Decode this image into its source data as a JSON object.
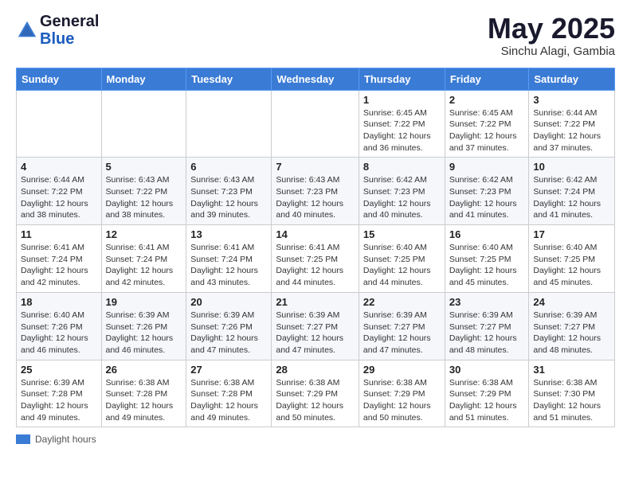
{
  "header": {
    "logo_general": "General",
    "logo_blue": "Blue",
    "title": "May 2025",
    "location": "Sinchu Alagi, Gambia"
  },
  "days_of_week": [
    "Sunday",
    "Monday",
    "Tuesday",
    "Wednesday",
    "Thursday",
    "Friday",
    "Saturday"
  ],
  "weeks": [
    [
      {
        "day": "",
        "sunrise": "",
        "sunset": "",
        "daylight": ""
      },
      {
        "day": "",
        "sunrise": "",
        "sunset": "",
        "daylight": ""
      },
      {
        "day": "",
        "sunrise": "",
        "sunset": "",
        "daylight": ""
      },
      {
        "day": "",
        "sunrise": "",
        "sunset": "",
        "daylight": ""
      },
      {
        "day": "1",
        "sunrise": "Sunrise: 6:45 AM",
        "sunset": "Sunset: 7:22 PM",
        "daylight": "Daylight: 12 hours and 36 minutes."
      },
      {
        "day": "2",
        "sunrise": "Sunrise: 6:45 AM",
        "sunset": "Sunset: 7:22 PM",
        "daylight": "Daylight: 12 hours and 37 minutes."
      },
      {
        "day": "3",
        "sunrise": "Sunrise: 6:44 AM",
        "sunset": "Sunset: 7:22 PM",
        "daylight": "Daylight: 12 hours and 37 minutes."
      }
    ],
    [
      {
        "day": "4",
        "sunrise": "Sunrise: 6:44 AM",
        "sunset": "Sunset: 7:22 PM",
        "daylight": "Daylight: 12 hours and 38 minutes."
      },
      {
        "day": "5",
        "sunrise": "Sunrise: 6:43 AM",
        "sunset": "Sunset: 7:22 PM",
        "daylight": "Daylight: 12 hours and 38 minutes."
      },
      {
        "day": "6",
        "sunrise": "Sunrise: 6:43 AM",
        "sunset": "Sunset: 7:23 PM",
        "daylight": "Daylight: 12 hours and 39 minutes."
      },
      {
        "day": "7",
        "sunrise": "Sunrise: 6:43 AM",
        "sunset": "Sunset: 7:23 PM",
        "daylight": "Daylight: 12 hours and 40 minutes."
      },
      {
        "day": "8",
        "sunrise": "Sunrise: 6:42 AM",
        "sunset": "Sunset: 7:23 PM",
        "daylight": "Daylight: 12 hours and 40 minutes."
      },
      {
        "day": "9",
        "sunrise": "Sunrise: 6:42 AM",
        "sunset": "Sunset: 7:23 PM",
        "daylight": "Daylight: 12 hours and 41 minutes."
      },
      {
        "day": "10",
        "sunrise": "Sunrise: 6:42 AM",
        "sunset": "Sunset: 7:24 PM",
        "daylight": "Daylight: 12 hours and 41 minutes."
      }
    ],
    [
      {
        "day": "11",
        "sunrise": "Sunrise: 6:41 AM",
        "sunset": "Sunset: 7:24 PM",
        "daylight": "Daylight: 12 hours and 42 minutes."
      },
      {
        "day": "12",
        "sunrise": "Sunrise: 6:41 AM",
        "sunset": "Sunset: 7:24 PM",
        "daylight": "Daylight: 12 hours and 42 minutes."
      },
      {
        "day": "13",
        "sunrise": "Sunrise: 6:41 AM",
        "sunset": "Sunset: 7:24 PM",
        "daylight": "Daylight: 12 hours and 43 minutes."
      },
      {
        "day": "14",
        "sunrise": "Sunrise: 6:41 AM",
        "sunset": "Sunset: 7:25 PM",
        "daylight": "Daylight: 12 hours and 44 minutes."
      },
      {
        "day": "15",
        "sunrise": "Sunrise: 6:40 AM",
        "sunset": "Sunset: 7:25 PM",
        "daylight": "Daylight: 12 hours and 44 minutes."
      },
      {
        "day": "16",
        "sunrise": "Sunrise: 6:40 AM",
        "sunset": "Sunset: 7:25 PM",
        "daylight": "Daylight: 12 hours and 45 minutes."
      },
      {
        "day": "17",
        "sunrise": "Sunrise: 6:40 AM",
        "sunset": "Sunset: 7:25 PM",
        "daylight": "Daylight: 12 hours and 45 minutes."
      }
    ],
    [
      {
        "day": "18",
        "sunrise": "Sunrise: 6:40 AM",
        "sunset": "Sunset: 7:26 PM",
        "daylight": "Daylight: 12 hours and 46 minutes."
      },
      {
        "day": "19",
        "sunrise": "Sunrise: 6:39 AM",
        "sunset": "Sunset: 7:26 PM",
        "daylight": "Daylight: 12 hours and 46 minutes."
      },
      {
        "day": "20",
        "sunrise": "Sunrise: 6:39 AM",
        "sunset": "Sunset: 7:26 PM",
        "daylight": "Daylight: 12 hours and 47 minutes."
      },
      {
        "day": "21",
        "sunrise": "Sunrise: 6:39 AM",
        "sunset": "Sunset: 7:27 PM",
        "daylight": "Daylight: 12 hours and 47 minutes."
      },
      {
        "day": "22",
        "sunrise": "Sunrise: 6:39 AM",
        "sunset": "Sunset: 7:27 PM",
        "daylight": "Daylight: 12 hours and 47 minutes."
      },
      {
        "day": "23",
        "sunrise": "Sunrise: 6:39 AM",
        "sunset": "Sunset: 7:27 PM",
        "daylight": "Daylight: 12 hours and 48 minutes."
      },
      {
        "day": "24",
        "sunrise": "Sunrise: 6:39 AM",
        "sunset": "Sunset: 7:27 PM",
        "daylight": "Daylight: 12 hours and 48 minutes."
      }
    ],
    [
      {
        "day": "25",
        "sunrise": "Sunrise: 6:39 AM",
        "sunset": "Sunset: 7:28 PM",
        "daylight": "Daylight: 12 hours and 49 minutes."
      },
      {
        "day": "26",
        "sunrise": "Sunrise: 6:38 AM",
        "sunset": "Sunset: 7:28 PM",
        "daylight": "Daylight: 12 hours and 49 minutes."
      },
      {
        "day": "27",
        "sunrise": "Sunrise: 6:38 AM",
        "sunset": "Sunset: 7:28 PM",
        "daylight": "Daylight: 12 hours and 49 minutes."
      },
      {
        "day": "28",
        "sunrise": "Sunrise: 6:38 AM",
        "sunset": "Sunset: 7:29 PM",
        "daylight": "Daylight: 12 hours and 50 minutes."
      },
      {
        "day": "29",
        "sunrise": "Sunrise: 6:38 AM",
        "sunset": "Sunset: 7:29 PM",
        "daylight": "Daylight: 12 hours and 50 minutes."
      },
      {
        "day": "30",
        "sunrise": "Sunrise: 6:38 AM",
        "sunset": "Sunset: 7:29 PM",
        "daylight": "Daylight: 12 hours and 51 minutes."
      },
      {
        "day": "31",
        "sunrise": "Sunrise: 6:38 AM",
        "sunset": "Sunset: 7:30 PM",
        "daylight": "Daylight: 12 hours and 51 minutes."
      }
    ]
  ],
  "legend": {
    "daylight_hours": "Daylight hours"
  }
}
